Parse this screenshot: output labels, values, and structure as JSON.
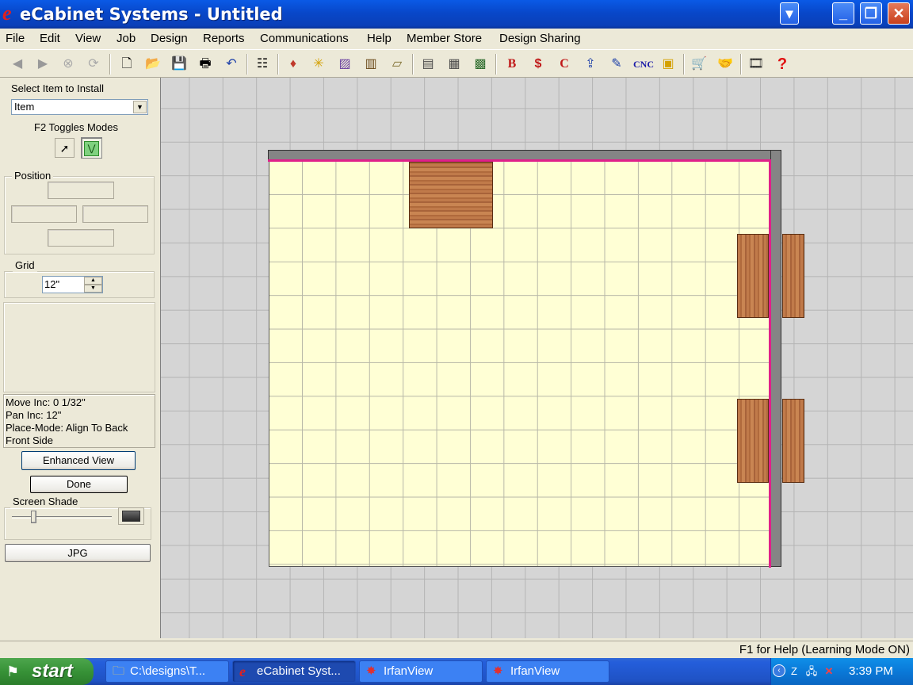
{
  "window": {
    "title": "eCabinet Systems - Untitled",
    "logo": "e"
  },
  "menu": [
    "File",
    "Edit",
    "View",
    "Job",
    "Design",
    "Reports",
    "Communications",
    "Help",
    "Member Store",
    "Design Sharing"
  ],
  "toolbar": {
    "cnc_label": "CNC",
    "b_label": "B",
    "s_label": "$",
    "c_label": "C",
    "help_label": "?"
  },
  "left_panel": {
    "select_item_label": "Select Item to Install",
    "select_item_value": "Item",
    "toggles_label": "F2 Toggles Modes",
    "position_label": "Position",
    "grid_label": "Grid",
    "grid_value": "12\"",
    "status_lines": [
      "Move Inc: 0 1/32\"",
      "Pan Inc: 12\"",
      "Place-Mode: Align To Back",
      "Front Side"
    ],
    "enhanced_view_label": "Enhanced View",
    "done_label": "Done",
    "screen_shade_label": "Screen Shade",
    "screen_shade_level": 0.2,
    "jpg_label": "JPG"
  },
  "statusbar": {
    "text": "F1 for Help (Learning Mode ON)"
  },
  "taskbar": {
    "start_label": "start",
    "tasks": [
      "C:\\designs\\T...",
      "eCabinet Syst...",
      "IrfanView",
      "IrfanView"
    ],
    "clock": "3:39 PM"
  },
  "colors": {
    "titlebar": "#0a5ae6",
    "floor": "#ffffd5",
    "wall_edge": "#e0208a",
    "cabinet": "#c07a4a"
  },
  "icons": [
    "back-arrow-icon",
    "forward-arrow-icon",
    "stop-icon",
    "refresh-icon",
    "new-file-icon",
    "open-folder-icon",
    "save-icon",
    "print-icon",
    "undo-icon"
  ]
}
